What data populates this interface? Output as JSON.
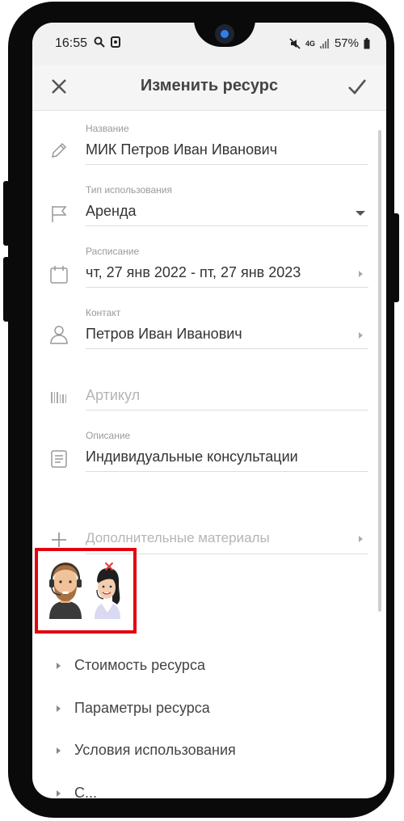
{
  "status_bar": {
    "time": "16:55",
    "network": "4G",
    "battery": "57%"
  },
  "app_bar": {
    "title": "Изменить ресурс",
    "close_icon": "close-icon",
    "confirm_icon": "check-icon"
  },
  "form": {
    "name": {
      "label": "Название",
      "value": "МИК Петров Иван Иванович",
      "icon": "pencil-icon"
    },
    "usage_type": {
      "label": "Тип использования",
      "value": "Аренда",
      "icon": "flag-icon"
    },
    "schedule": {
      "label": "Расписание",
      "value": "чт, 27 янв 2022 - пт, 27 янв 2023",
      "icon": "calendar-icon"
    },
    "contact": {
      "label": "Контакт",
      "value": "Петров Иван Иванович",
      "icon": "person-icon"
    },
    "article": {
      "placeholder": "Артикул",
      "icon": "barcode-icon"
    },
    "description": {
      "label": "Описание",
      "value": "Индивидуальные консультации",
      "icon": "document-icon"
    },
    "materials": {
      "placeholder": "Дополнительные материалы",
      "icon": "plus-icon"
    }
  },
  "images": {
    "items": [
      "male-avatar-headset",
      "female-avatar-headset"
    ],
    "highlight_color": "#e3000f",
    "remove_icon": "remove-x-icon"
  },
  "sections": [
    {
      "label": "Стоимость ресурса"
    },
    {
      "label": "Параметры ресурса"
    },
    {
      "label": "Условия использования"
    },
    {
      "label": "С..."
    }
  ],
  "colors": {
    "text_primary": "#333333",
    "text_label": "#9a9a9a",
    "placeholder": "#b5b5b5",
    "divider": "#dddddd",
    "highlight": "#e3000f",
    "remove_x": "#e53935"
  }
}
